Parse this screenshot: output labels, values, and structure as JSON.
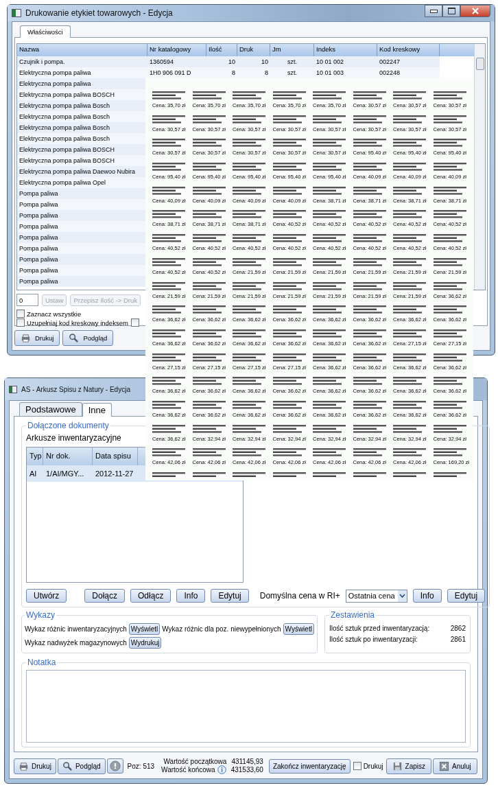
{
  "window_labels": {
    "title": "Drukowanie etykiet towarowych - Edycja",
    "tabs": [
      {
        "label": "Właściwości",
        "selected": true
      }
    ],
    "table": {
      "columns": [
        "Nazwa",
        "Nr katalogowy",
        "Ilość",
        "Druk",
        "Jm",
        "Indeks",
        "Kod kreskowy"
      ],
      "rows": [
        {
          "name": "Czujnik i pompa.",
          "catalog_no": "1360594",
          "qty": "10",
          "print": "10",
          "unit": "szt.",
          "index": "10 01 002",
          "barcode": "002247"
        },
        {
          "name": "Elektryczna pompa paliwa",
          "catalog_no": "1H0 906 091 D",
          "qty": "8",
          "print": "8",
          "unit": "szt.",
          "index": "10 01 003",
          "barcode": "002248"
        },
        {
          "name": "Elektryczna pompa paliwa"
        },
        {
          "name": "Elektryczna pompa paliwa  BOSCH"
        },
        {
          "name": "Elektryczna pompa paliwa Bosch"
        },
        {
          "name": "Elektryczna pompa paliwa Bosch"
        },
        {
          "name": "Elektryczna pompa paliwa Bosch"
        },
        {
          "name": "Elektryczna pompa paliwa Bosch"
        },
        {
          "name": "Elektryczna pompa paliwa BOSCH"
        },
        {
          "name": "Elektryczna pompa paliwa BOSCH"
        },
        {
          "name": "Elektryczna pompa paliwa Daewoo Nubira"
        },
        {
          "name": "Elektryczna pompa paliwa Opel"
        },
        {
          "name": "Pompa paliwa"
        },
        {
          "name": "Pompa paliwa"
        },
        {
          "name": "Pompa paliwa"
        },
        {
          "name": "Pompa paliwa"
        },
        {
          "name": "Pompa paliwa"
        },
        {
          "name": "Pompa paliwa"
        },
        {
          "name": "Pompa paliwa"
        },
        {
          "name": "Pompa paliwa"
        },
        {
          "name": "Pompa paliwa"
        }
      ]
    },
    "count_value": "0",
    "set_button": {
      "label": "Ustaw",
      "disabled": true
    },
    "copy_button": {
      "label": "Przepisz Ilość -> Druk",
      "disabled": true
    },
    "checkboxes": [
      {
        "label": "Zaznacz wszystkie",
        "checked": false
      },
      {
        "label": "Uzupełniaj kod kreskowy indeksem",
        "checked": false
      }
    ],
    "extra_checkbox": {
      "checked": false
    },
    "buttons": [
      "Drukuj",
      "Podgląd"
    ]
  },
  "window_inventory": {
    "title": "AS - Arkusz Spisu z Natury - Edycja",
    "tabs": [
      {
        "label": "Podstawowe",
        "selected": false
      },
      {
        "label": "Inne",
        "selected": true
      }
    ],
    "attached": {
      "title": "Dołączone dokumenty",
      "subtitle": "Arkusze inwentaryzacyjne",
      "columns": [
        "Typ",
        "Nr dok.",
        "Data spisu"
      ],
      "rows": [
        {
          "type": "AI",
          "number": "1/AI/MGY...",
          "date": "2012-11-27"
        }
      ],
      "buttons": [
        "Utwórz",
        "Dołącz",
        "Odłącz",
        "Info",
        "Edytuj"
      ],
      "price_label": "Domyślna cena w RI+",
      "price_value": "Ostatnia cena",
      "buttons_right": [
        "Info",
        "Edytuj"
      ]
    },
    "reports": {
      "title": "Wykazy",
      "rows": [
        {
          "label": "Wykaz różnic inwentaryzacyjnych",
          "button": "Wyświetl"
        },
        {
          "label": "Wykaz różnic dla poz. niewypełnionych",
          "button": "Wyświetl"
        },
        {
          "label": "Wykaz nadwyżek magazynowych",
          "button": "Wydrukuj"
        }
      ]
    },
    "summary": {
      "title": "Zestawienia",
      "rows": [
        {
          "label": "Ilość sztuk przed inwentaryzacją:",
          "value": "2862"
        },
        {
          "label": "Ilość sztuk po inwentaryzacji:",
          "value": "2861"
        }
      ]
    },
    "note": {
      "title": "Notatka"
    },
    "footer": {
      "print": "Drukuj",
      "preview": "Podgląd",
      "position": "Poz: 513",
      "start_label": "Wartość początkowa",
      "start_value": "431145,93",
      "end_label": "Wartość końcowa",
      "end_value": "431533,60",
      "finish": "Zakończ inwentaryzację",
      "print_check": {
        "label": "Drukuj",
        "checked": false
      },
      "save": "Zapisz",
      "cancel": "Anuluj"
    }
  },
  "label_sheet": {
    "rows": [
      [
        "Cena: 35,70 zł",
        "Cena: 35,70 zł",
        "Cena: 35,70 zł",
        "Cena: 35,70 zł",
        "Cena: 35,70 zł",
        "Cena: 30,57 zł",
        "Cena: 30,57 zł",
        "Cena: 30,57 zł"
      ],
      [
        "Cena: 30,57 zł",
        "Cena: 30,57 zł",
        "Cena: 30,57 zł",
        "Cena: 30,57 zł",
        "Cena: 30,57 zł",
        "Cena: 30,57 zł",
        "Cena: 30,57 zł",
        "Cena: 30,57 zł"
      ],
      [
        "Cena: 30,57 zł",
        "Cena: 30,57 zł",
        "Cena: 30,57 zł",
        "Cena: 30,57 zł",
        "Cena: 30,57 zł",
        "Cena: 95,40 zł",
        "Cena: 95,40 zł",
        "Cena: 95,40 zł"
      ],
      [
        "Cena: 95,40 zł",
        "Cena: 95,40 zł",
        "Cena: 95,40 zł",
        "Cena: 95,40 zł",
        "Cena: 95,40 zł",
        "Cena: 40,09 zł",
        "Cena: 40,09 zł",
        "Cena: 40,09 zł"
      ],
      [
        "Cena: 40,09 zł",
        "Cena: 40,09 zł",
        "Cena: 40,09 zł",
        "Cena: 40,09 zł",
        "Cena: 38,71 zł",
        "Cena: 38,71 zł",
        "Cena: 38,71 zł",
        "Cena: 38,71 zł"
      ],
      [
        "Cena: 38,71 zł",
        "Cena: 38,71 zł",
        "Cena: 38,71 zł",
        "Cena: 40,52 zł",
        "Cena: 40,52 zł",
        "Cena: 40,52 zł",
        "Cena: 40,52 zł",
        "Cena: 40,52 zł"
      ],
      [
        "Cena: 40,52 zł",
        "Cena: 40,52 zł",
        "Cena: 40,52 zł",
        "Cena: 40,52 zł",
        "Cena: 40,52 zł",
        "Cena: 40,52 zł",
        "Cena: 40,52 zł",
        "Cena: 40,52 zł"
      ],
      [
        "Cena: 40,52 zł",
        "Cena: 40,52 zł",
        "Cena: 21,59 zł",
        "Cena: 21,59 zł",
        "Cena: 21,59 zł",
        "Cena: 21,59 zł",
        "Cena: 21,59 zł",
        "Cena: 21,59 zł"
      ],
      [
        "Cena: 21,59 zł",
        "Cena: 21,59 zł",
        "Cena: 21,59 zł",
        "Cena: 21,59 zł",
        "Cena: 21,59 zł",
        "Cena: 21,59 zł",
        "Cena: 21,59 zł",
        "Cena: 36,62 zł"
      ],
      [
        "Cena: 36,62 zł",
        "Cena: 36,62 zł",
        "Cena: 36,62 zł",
        "Cena: 36,62 zł",
        "Cena: 36,62 zł",
        "Cena: 36,62 zł",
        "Cena: 36,62 zł",
        "Cena: 36,62 zł"
      ],
      [
        "Cena: 36,62 zł",
        "Cena: 36,62 zł",
        "Cena: 36,62 zł",
        "Cena: 36,62 zł",
        "Cena: 36,62 zł",
        "Cena: 36,62 zł",
        "Cena: 27,15 zł",
        "Cena: 27,15 zł"
      ],
      [
        "Cena: 27,15 zł",
        "Cena: 27,15 zł",
        "Cena: 27,15 zł",
        "Cena: 27,15 zł",
        "Cena: 36,62 zł",
        "Cena: 36,62 zł",
        "Cena: 36,62 zł",
        "Cena: 36,62 zł"
      ],
      [
        "Cena: 36,62 zł",
        "Cena: 36,62 zł",
        "Cena: 36,62 zł",
        "Cena: 36,62 zł",
        "Cena: 36,62 zł",
        "Cena: 36,62 zł",
        "Cena: 36,62 zł",
        "Cena: 36,62 zł"
      ],
      [
        "Cena: 36,62 zł",
        "Cena: 36,62 zł",
        "Cena: 36,62 zł",
        "Cena: 36,62 zł",
        "Cena: 36,62 zł",
        "Cena: 36,62 zł",
        "Cena: 36,62 zł",
        "Cena: 36,62 zł"
      ],
      [
        "Cena: 36,62 zł",
        "Cena: 32,94 zł",
        "Cena: 32,94 zł",
        "Cena: 32,94 zł",
        "Cena: 32,94 zł",
        "Cena: 32,94 zł",
        "Cena: 32,94 zł",
        "Cena: 32,94 zł"
      ],
      [
        "Cena: 42,06 zł",
        "Cena: 42,06 zł",
        "Cena: 42,06 zł",
        "Cena: 42,06 zł",
        "Cena: 42,06 zł",
        "Cena: 42,06 zł",
        "Cena: 42,06 zł",
        "Cena: 169,20 zł"
      ]
    ]
  }
}
